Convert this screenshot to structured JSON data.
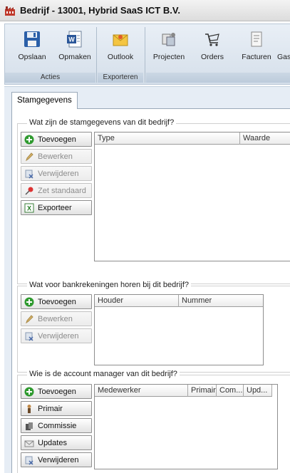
{
  "window": {
    "title": "Bedrijf - 13001, Hybrid SaaS ICT B.V."
  },
  "ribbon": {
    "groups": [
      {
        "label": "Acties",
        "buttons": [
          {
            "label": "Opslaan",
            "icon": "save-icon"
          },
          {
            "label": "Opmaken",
            "icon": "word-document-icon"
          }
        ]
      },
      {
        "label": "Exporteren",
        "buttons": [
          {
            "label": "Outlook",
            "icon": "outlook-envelope-icon"
          }
        ]
      },
      {
        "label": "",
        "buttons": [
          {
            "label": "Projecten",
            "icon": "projects-icon"
          },
          {
            "label": "Orders",
            "icon": "orders-cart-icon"
          },
          {
            "label": "Facturen",
            "icon": "invoice-icon"
          },
          {
            "label": "Gas",
            "icon": "gas-icon"
          }
        ]
      }
    ]
  },
  "tabs": [
    {
      "label": "Stamgegevens"
    }
  ],
  "sections": {
    "stamgegevens": {
      "title": "Wat zijn de stamgegevens van dit bedrijf?",
      "buttons": [
        {
          "label": "Toevoegen",
          "icon": "add-green-icon",
          "enabled": true
        },
        {
          "label": "Bewerken",
          "icon": "pencil-icon",
          "enabled": false
        },
        {
          "label": "Verwijderen",
          "icon": "delete-icon",
          "enabled": false
        },
        {
          "label": "Zet standaard",
          "icon": "pin-icon",
          "enabled": false
        },
        {
          "label": "Exporteer",
          "icon": "excel-icon",
          "enabled": true
        }
      ],
      "columns": [
        "Type",
        "Waarde"
      ]
    },
    "bankrekeningen": {
      "title": "Wat voor bankrekeningen horen bij dit bedrijf?",
      "buttons": [
        {
          "label": "Toevoegen",
          "icon": "add-green-icon",
          "enabled": true
        },
        {
          "label": "Bewerken",
          "icon": "pencil-icon",
          "enabled": false
        },
        {
          "label": "Verwijderen",
          "icon": "delete-icon",
          "enabled": false
        }
      ],
      "columns": [
        "Houder",
        "Nummer"
      ]
    },
    "accountmanager": {
      "title": "Wie is de account manager van dit bedrijf?",
      "buttons": [
        {
          "label": "Toevoegen",
          "icon": "add-green-icon",
          "enabled": true
        },
        {
          "label": "Primair",
          "icon": "person-icon",
          "enabled": true
        },
        {
          "label": "Commissie",
          "icon": "money-icon",
          "enabled": true
        },
        {
          "label": "Updates",
          "icon": "updates-envelope-icon",
          "enabled": true
        },
        {
          "label": "Verwijderen",
          "icon": "delete-icon",
          "enabled": true
        }
      ],
      "columns": [
        "Medewerker",
        "Primair",
        "Com...",
        "Upd..."
      ]
    }
  },
  "colors": {
    "accent": "#1f4e8c",
    "add_green": "#2f9a2f",
    "ribbon_bg": "#dfe7f0"
  }
}
